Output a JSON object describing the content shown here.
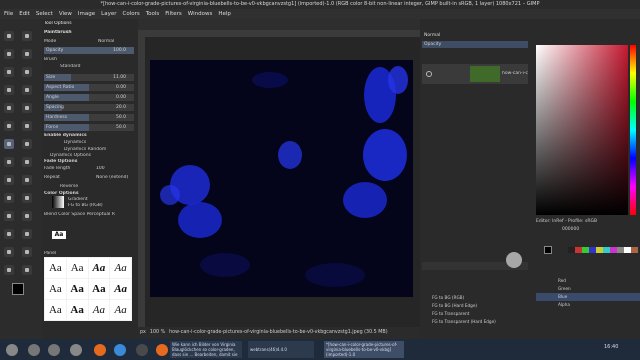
{
  "window": {
    "title": "*[how-can-i-color-grade-pictures-of-virginia-bluebells-to-be-v0-vkbgcanvzstg1] (imported)-1.0 (RGB color 8-bit non-linear integer, GIMP built-in sRGB, 1 layer) 1080x721 – GIMP"
  },
  "menubar": [
    "File",
    "Edit",
    "Select",
    "View",
    "Image",
    "Layer",
    "Colors",
    "Tools",
    "Filters",
    "Windows",
    "Help"
  ],
  "tooloptions": {
    "tab_label": "Tool Options",
    "tool_name": "Paintbrush",
    "mode_label": "Mode",
    "mode_value": "Normal",
    "opacity_label": "Opacity",
    "opacity_value": "100.0",
    "brush_label": "Brush",
    "brush_value": "Standard",
    "size_label": "Size",
    "size_value": "11.00",
    "aspect_label": "Aspect Ratio",
    "aspect_value": "0.00",
    "angle_label": "Angle",
    "angle_value": "0.00",
    "spacing_label": "Spacing",
    "spacing_value": "20.0",
    "hardness_label": "Hardness",
    "hardness_value": "50.0",
    "force_label": "Force",
    "force_value": "50.0",
    "enable_dynamics": "Enable dynamics",
    "dynamics_label": "Dynamics",
    "dynamics_value": "Dynamics Random",
    "dynamics_options": "Dynamics Options",
    "fade_options": "Fade Options",
    "fade_length_label": "Fade length",
    "fade_length_value": "100",
    "repeat_label": "Repeat",
    "repeat_value": "None (extend)",
    "reverse_label": "Reverse",
    "color_options": "Color Options",
    "gradient_label": "Gradient",
    "gradient_value": "FG to BG (RGB)",
    "blend_space": "Blend Color Space Perceptual R",
    "font_tab": "Aa",
    "font_panel_label": "Panel"
  },
  "font_samples": [
    "Aa",
    "Aa",
    "Aa",
    "Aa",
    "Aa",
    "Aa",
    "Aa",
    "Aa",
    "Aa",
    "Aa",
    "Aa",
    "Aa"
  ],
  "layers": {
    "mode_value": "Normal",
    "opacity_label": "Opacity",
    "layer_name": "how-can-i-co",
    "gradient_list": [
      "FG to BG (RGB)",
      "FG to BG (Hard Edge)",
      "FG to Transparent",
      "FG to Transparent (Hard Edge)"
    ]
  },
  "colors": {
    "profile_label": "Editor: lnRef - Profile: sRGB",
    "hex_value": "000000",
    "channels": [
      "Red",
      "Green",
      "Blue",
      "Alpha"
    ],
    "accent": "#7a1e2e"
  },
  "status": {
    "unit": "px",
    "zoom": "100 %",
    "file_label": "how-can-i-color-grade-pictures-of-virginia-bluebells-to-be-v0-vkbgcanvzstg1.jpeg (30.5 MB)"
  },
  "taskbar": {
    "window_1": "Wie kann ich Bilder von Virginia Blauglöckchen so color-graden, dass sie ... Bearbeiten, damit sie blauer ...",
    "window_2": "webtrans(46)4.4.0",
    "window_3": "*[how-can-i-color-grade-pictures-of-virginia-bluebells-to-be-v0-vkbg] (imported)-1.0",
    "clock": "16:40"
  }
}
